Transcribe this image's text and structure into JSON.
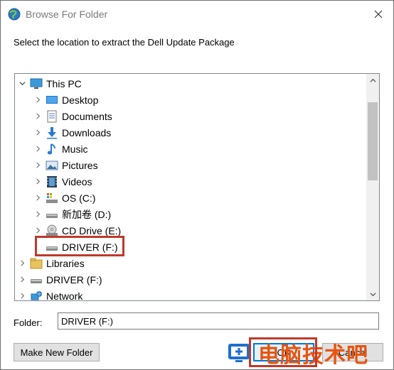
{
  "window": {
    "title": "Browse For Folder",
    "close_icon": "close-icon"
  },
  "instruction": "Select the location to extract the Dell Update Package",
  "tree": {
    "items": [
      {
        "label": "This PC",
        "icon": "computer-icon",
        "expander": "expanded",
        "level": 0
      },
      {
        "label": "Desktop",
        "icon": "desktop-icon",
        "expander": "collapsed",
        "level": 1
      },
      {
        "label": "Documents",
        "icon": "documents-icon",
        "expander": "collapsed",
        "level": 1
      },
      {
        "label": "Downloads",
        "icon": "downloads-icon",
        "expander": "collapsed",
        "level": 1
      },
      {
        "label": "Music",
        "icon": "music-icon",
        "expander": "collapsed",
        "level": 1
      },
      {
        "label": "Pictures",
        "icon": "pictures-icon",
        "expander": "collapsed",
        "level": 1
      },
      {
        "label": "Videos",
        "icon": "videos-icon",
        "expander": "collapsed",
        "level": 1
      },
      {
        "label": "OS (C:)",
        "icon": "os-drive-icon",
        "expander": "collapsed",
        "level": 1
      },
      {
        "label": "新加卷 (D:)",
        "icon": "drive-icon",
        "expander": "collapsed",
        "level": 1
      },
      {
        "label": "CD Drive (E:)",
        "icon": "cd-drive-icon",
        "expander": "collapsed",
        "level": 1
      },
      {
        "label": "DRIVER (F:)",
        "icon": "drive-icon",
        "expander": "none",
        "level": 1,
        "selected": true
      },
      {
        "label": "Libraries",
        "icon": "libraries-icon",
        "expander": "collapsed",
        "level": 0
      },
      {
        "label": "DRIVER (F:)",
        "icon": "drive-icon",
        "expander": "collapsed",
        "level": 0
      },
      {
        "label": "Network",
        "icon": "network-icon",
        "expander": "collapsed",
        "level": 0
      }
    ]
  },
  "folder": {
    "label": "Folder:",
    "value": "DRIVER (F:)"
  },
  "buttons": {
    "make_new_folder": "Make New Folder",
    "ok": "OK",
    "cancel": "Cancel"
  },
  "watermark": {
    "text": "电脑技术吧"
  },
  "colors": {
    "highlight": "#c0392b",
    "accent": "#0078d7",
    "watermark": "#e8540f"
  }
}
